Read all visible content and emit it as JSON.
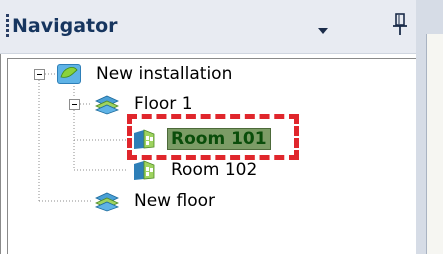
{
  "navigator": {
    "title": "Navigator",
    "dropdown_icon": "chevron-down-icon",
    "pin_icon": "pin-icon"
  },
  "tree": {
    "root": {
      "label": "New installation",
      "icon": "installation-icon",
      "expanded": true
    },
    "floor1": {
      "label": "Floor 1",
      "icon": "floor-icon",
      "expanded": true
    },
    "room101": {
      "label": "Room 101",
      "icon": "room-icon",
      "selected": true
    },
    "room102": {
      "label": "Room 102",
      "icon": "room-icon"
    },
    "newfloor": {
      "label": "New floor",
      "icon": "floor-icon"
    }
  },
  "colors": {
    "selection": "#7c9c66",
    "highlight": "#e0262c",
    "header": "#e8ebf2",
    "title": "#16355f"
  }
}
